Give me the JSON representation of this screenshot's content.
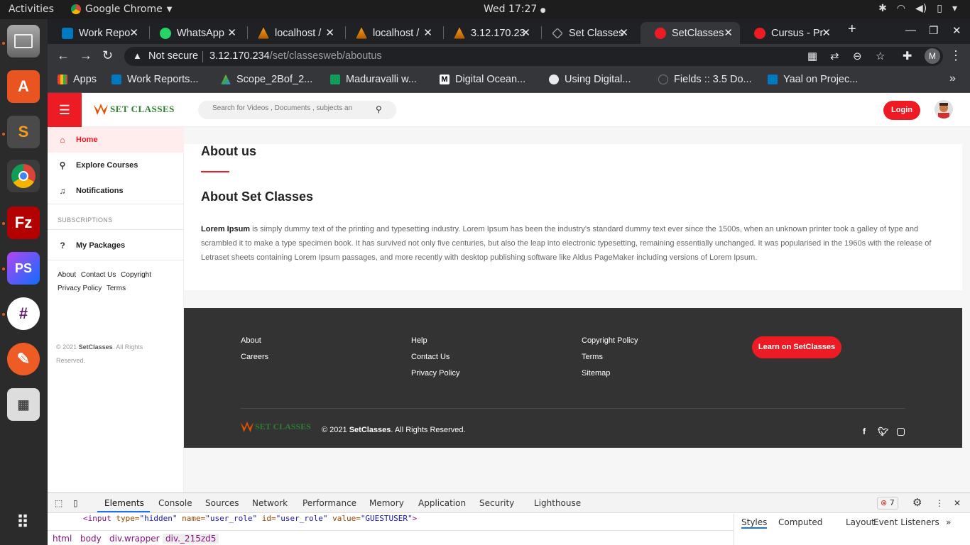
{
  "os": {
    "activities": "Activities",
    "app_menu": "Google Chrome",
    "clock": "Wed 17:27"
  },
  "chrome": {
    "tabs": [
      {
        "title": "Work Repo"
      },
      {
        "title": "WhatsApp"
      },
      {
        "title": "localhost /"
      },
      {
        "title": "localhost /"
      },
      {
        "title": "3.12.170.23"
      },
      {
        "title": "Set Classes"
      },
      {
        "title": "SetClasses"
      },
      {
        "title": "Cursus - Pr"
      }
    ],
    "address": {
      "security": "Not secure",
      "host": "3.12.170.234",
      "path": "/set/classesweb/aboutus"
    },
    "profile_initial": "M",
    "bookmarks": [
      {
        "label": "Apps"
      },
      {
        "label": "Work Reports..."
      },
      {
        "label": "Scope_2Bof_2..."
      },
      {
        "label": "Maduravalli w..."
      },
      {
        "label": "Digital Ocean..."
      },
      {
        "label": "Using Digital..."
      },
      {
        "label": "Fields :: 3.5 Do..."
      },
      {
        "label": "Yaal on Projec..."
      }
    ]
  },
  "site": {
    "logo_text": "SET CLASSES",
    "search_placeholder": "Search for Videos , Documents , subjects an",
    "login": "Login",
    "sidebar": {
      "items": [
        {
          "label": "Home"
        },
        {
          "label": "Explore Courses"
        },
        {
          "label": "Notifications"
        }
      ],
      "subscriptions_heading": "SUBSCRIPTIONS",
      "packages": "My Packages",
      "links_row1": [
        "About",
        "Contact Us",
        "Copyright"
      ],
      "links_row2": [
        "Privacy Policy",
        "Terms"
      ],
      "copyright_prefix": "© 2021 ",
      "copyright_brand": "SetClasses",
      "copyright_suffix": ". All Rights Reserved."
    },
    "main": {
      "title": "About us",
      "subtitle": "About Set Classes",
      "lead": "Lorem Ipsum",
      "body": " is simply dummy text of the printing and typesetting industry. Lorem Ipsum has been the industry's standard dummy text ever since the 1500s, when an unknown printer took a galley of type and scrambled it to make a type specimen book. It has survived not only five centuries, but also the leap into electronic typesetting, remaining essentially unchanged. It was popularised in the 1960s with the release of Letraset sheets containing Lorem Ipsum passages, and more recently with desktop publishing software like Aldus PageMaker including versions of Lorem Ipsum."
    },
    "footer": {
      "col1": [
        "About",
        "Careers"
      ],
      "col2": [
        "Help",
        "Contact Us",
        "Privacy Policy"
      ],
      "col3": [
        "Copyright Policy",
        "Terms",
        "Sitemap"
      ],
      "cta": "Learn on SetClasses",
      "copyright_prefix": "© 2021 ",
      "copyright_brand": "SetClasses",
      "copyright_suffix": ". All Rights Reserved.",
      "social": [
        "facebook-icon",
        "twitter-icon",
        "instagram-icon"
      ]
    }
  },
  "devtools": {
    "tabs": [
      "Elements",
      "Console",
      "Sources",
      "Network",
      "Performance",
      "Memory",
      "Application",
      "Security",
      "Lighthouse"
    ],
    "error_count": "7",
    "code_tag": "<input",
    "code_attr1": " type=",
    "code_val1": "\"hidden\"",
    "code_attr2": " name=",
    "code_val2": "\"user_role\"",
    "code_attr3": " id=",
    "code_val3": "\"user_role\"",
    "code_attr4": " value=",
    "code_val4": "\"GUESTUSER\"",
    "code_end": ">",
    "breadcrumbs": [
      "html",
      "body",
      "div.wrapper",
      "div._215zd5"
    ],
    "side_tabs": [
      "Styles",
      "Computed",
      "Layout",
      "Event Listeners"
    ]
  },
  "colors": {
    "brand_red": "#ed1c24",
    "brand_green": "#2e7d32",
    "footer_bg": "#333333"
  }
}
